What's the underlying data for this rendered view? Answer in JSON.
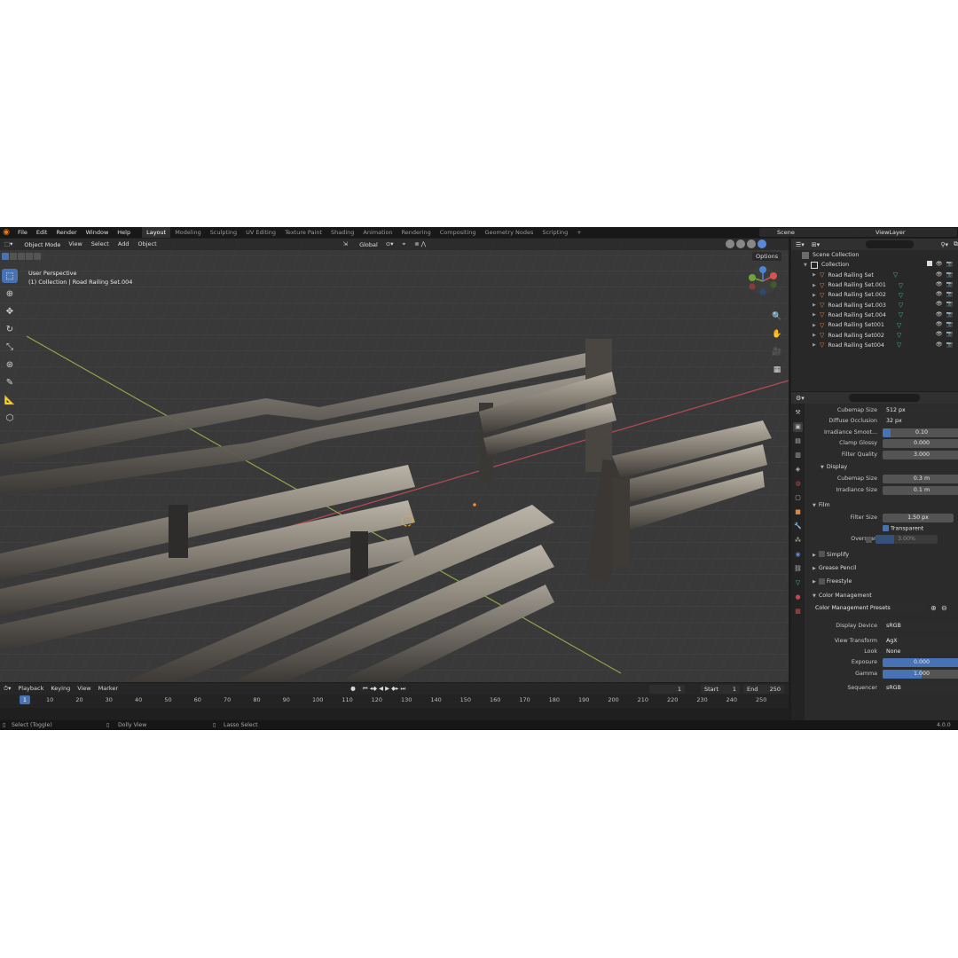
{
  "menu": [
    "File",
    "Edit",
    "Render",
    "Window",
    "Help"
  ],
  "workspaces": [
    "Layout",
    "Modeling",
    "Sculpting",
    "UV Editing",
    "Texture Paint",
    "Shading",
    "Animation",
    "Rendering",
    "Compositing",
    "Geometry Nodes",
    "Scripting",
    "+"
  ],
  "scene": "Scene",
  "view_layer": "ViewLayer",
  "viewport": {
    "mode": "Object Mode",
    "menus": [
      "View",
      "Select",
      "Add",
      "Object"
    ],
    "transform": "Global",
    "options": "Options",
    "info_line1": "User Perspective",
    "info_line2": "(1) Collection | Road Railing Set.004"
  },
  "timeline": {
    "menus": [
      "Playback",
      "Keying",
      "View",
      "Marker"
    ],
    "current_frame": "1",
    "start_label": "Start",
    "start": "1",
    "end_label": "End",
    "end": "250",
    "ticks": [
      "1",
      "10",
      "20",
      "30",
      "40",
      "50",
      "60",
      "70",
      "80",
      "90",
      "100",
      "110",
      "120",
      "130",
      "140",
      "150",
      "160",
      "170",
      "180",
      "190",
      "200",
      "210",
      "220",
      "230",
      "240",
      "250"
    ]
  },
  "status": {
    "select": "Select (Toggle)",
    "dolly": "Dolly View",
    "lasso": "Lasso Select",
    "version": "4.0.0"
  },
  "outliner": {
    "scene_collection": "Scene Collection",
    "collection": "Collection",
    "objects": [
      "Road Railing Set",
      "Road Railing Set.001",
      "Road Railing Set.002",
      "Road Railing Set.003",
      "Road Railing Set.004",
      "Road Railing Set001",
      "Road Railing Set002",
      "Road Railing Set004"
    ]
  },
  "properties": {
    "cubemap_size_label": "Cubemap Size",
    "cubemap_size": "512 px",
    "diffuse_occlusion_label": "Diffuse Occlusion",
    "diffuse_occlusion": "32 px",
    "irradiance_smooth_label": "Irradiance Smoot...",
    "irradiance_smooth": "0.10",
    "irradiance_smooth_fraction": 0.1,
    "clamp_glossy_label": "Clamp Glossy",
    "clamp_glossy": "0.000",
    "filter_quality_label": "Filter Quality",
    "filter_quality": "3.000",
    "display_section": "Display",
    "display_cubemap_label": "Cubemap Size",
    "display_cubemap": "0.3 m",
    "display_irradiance_label": "Irradiance Size",
    "display_irradiance": "0.1 m",
    "film_section": "Film",
    "filter_size_label": "Filter Size",
    "filter_size": "1.50 px",
    "transparent_label": "Transparent",
    "overscan_label": "Overscan",
    "overscan": "3.00%",
    "simplify_section": "Simplify",
    "grease_pencil_section": "Grease Pencil",
    "freestyle_section": "Freestyle",
    "color_management_section": "Color Management",
    "presets": "Color Management Presets",
    "display_device_label": "Display Device",
    "display_device": "sRGB",
    "view_transform_label": "View Transform",
    "view_transform": "AgX",
    "look_label": "Look",
    "look": "None",
    "exposure_label": "Exposure",
    "exposure": "0.000",
    "gamma_label": "Gamma",
    "gamma": "1.000",
    "sequencer_label": "Sequencer",
    "sequencer": "sRGB"
  },
  "colors": {
    "accent": "#4772b3",
    "object_icon": "#e5873a",
    "mesh_data_icon": "#3fbf8a"
  }
}
